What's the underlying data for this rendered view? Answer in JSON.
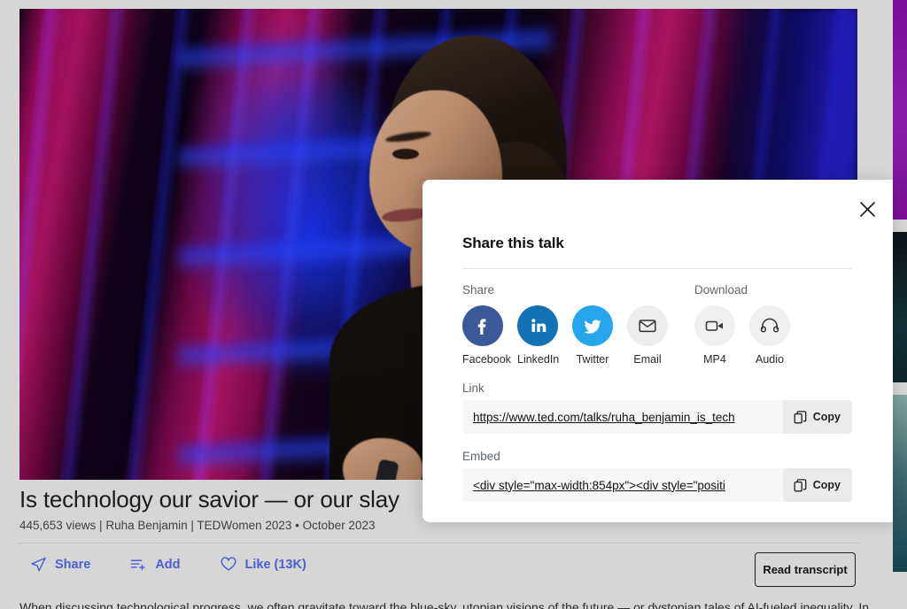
{
  "player": {
    "name": "ted-video-player",
    "alt": "Speaker Ruha Benjamin on a TED stage with magenta and blue striped lighting"
  },
  "sidebar": {
    "thumbnails": [
      "suggested-video-1",
      "suggested-video-2",
      "suggested-video-3"
    ]
  },
  "modal": {
    "title": "Share this talk",
    "close_label": "×",
    "share_section_label": "Share",
    "download_section_label": "Download",
    "share_targets": [
      {
        "label": "Facebook",
        "icon": "facebook-icon",
        "color": "#3b5998"
      },
      {
        "label": "LinkedIn",
        "icon": "linkedin-icon",
        "color": "#1272b5"
      },
      {
        "label": "Twitter",
        "icon": "twitter-icon",
        "color": "#27a5ea"
      },
      {
        "label": "Email",
        "icon": "email-icon",
        "color": "#ededed"
      }
    ],
    "download_targets": [
      {
        "label": "MP4",
        "icon": "video-camera-icon",
        "color": "#f0f0f0"
      },
      {
        "label": "Audio",
        "icon": "headphones-icon",
        "color": "#f0f0f0"
      }
    ],
    "link": {
      "label": "Link",
      "value": "https://www.ted.com/talks/ruha_benjamin_is_tech",
      "copy_label": "Copy"
    },
    "embed": {
      "label": "Embed",
      "value": "<div style=\"max-width:854px\"><div style=\"positi",
      "copy_label": "Copy"
    }
  },
  "talk": {
    "title": "Is technology our savior — or our slay",
    "views": "445,653 views",
    "separator": "|",
    "speaker": "Ruha Benjamin",
    "event": "TEDWomen 2023",
    "date_separator": "•",
    "date": "October 2023",
    "meta_line": "445,653 views | Ruha Benjamin | TEDWomen 2023 • October 2023"
  },
  "actions": [
    {
      "label": "Share",
      "icon": "paper-plane-icon"
    },
    {
      "label": "Add",
      "icon": "add-to-list-icon"
    },
    {
      "label": "Like (13K)",
      "icon": "heart-icon"
    }
  ],
  "transcript": {
    "label": "Read transcript"
  },
  "description": {
    "text": "When discussing technological progress, we often gravitate toward the blue-sky, utopian visions of the future — or dystopian tales of AI-fueled inequality. In her searing talk,"
  },
  "colors": {
    "accent_link": "#4a5fd0",
    "page_background": "#d6d6d6",
    "modal_background": "#ffffff",
    "field_background": "#f7f7f7"
  }
}
